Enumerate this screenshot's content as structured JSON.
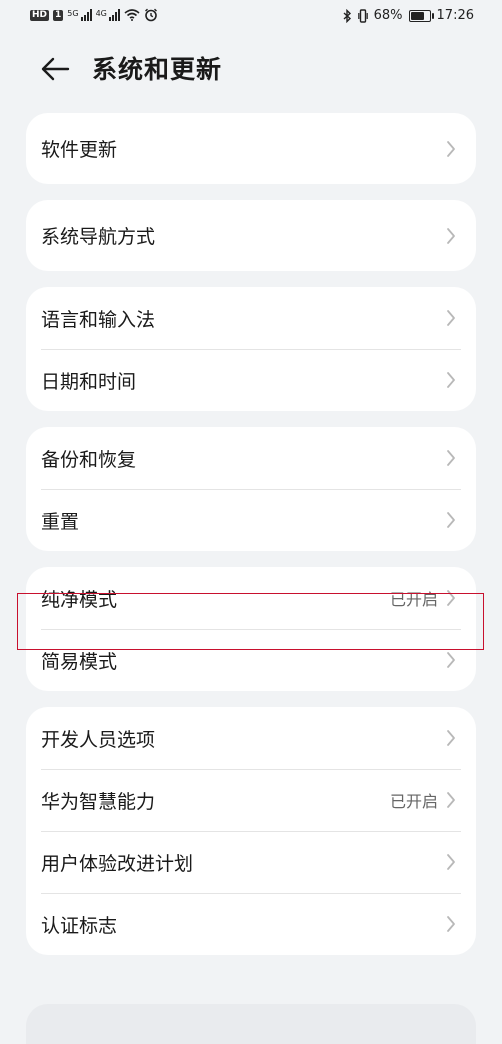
{
  "status_bar": {
    "hd_label": "HD",
    "sim_label": "1",
    "signal1_label": "5G",
    "signal2_label": "4G",
    "battery_text": "68%",
    "battery_level": 0.68,
    "time": "17:26"
  },
  "header": {
    "title": "系统和更新"
  },
  "groups": [
    {
      "items": [
        {
          "label": "软件更新",
          "value": ""
        }
      ]
    },
    {
      "items": [
        {
          "label": "系统导航方式",
          "value": ""
        }
      ]
    },
    {
      "items": [
        {
          "label": "语言和输入法",
          "value": ""
        },
        {
          "label": "日期和时间",
          "value": ""
        }
      ]
    },
    {
      "items": [
        {
          "label": "备份和恢复",
          "value": ""
        },
        {
          "label": "重置",
          "value": ""
        }
      ]
    },
    {
      "items": [
        {
          "label": "纯净模式",
          "value": "已开启"
        },
        {
          "label": "简易模式",
          "value": ""
        }
      ]
    },
    {
      "items": [
        {
          "label": "开发人员选项",
          "value": ""
        },
        {
          "label": "华为智慧能力",
          "value": "已开启"
        },
        {
          "label": "用户体验改进计划",
          "value": ""
        },
        {
          "label": "认证标志",
          "value": ""
        }
      ]
    }
  ],
  "highlight_color": "#c8102e"
}
